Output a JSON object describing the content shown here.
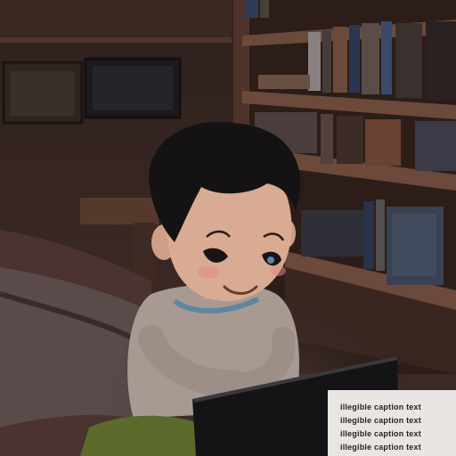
{
  "scene": {
    "palette": {
      "wall": "#3b2a27",
      "shelf_wood": "#5a3c30",
      "skin": "#d9ab93",
      "hair": "#141212",
      "shirt": "#b7aaa2",
      "tablet": "#141416",
      "pants": "#5c6a2c",
      "caption_bg": "#e9e5e2"
    },
    "icons": [
      "boy-figure",
      "bookshelf",
      "wall-picture",
      "bed",
      "tablet"
    ]
  },
  "caption": {
    "lines": [
      "illegible caption text",
      "illegible caption text",
      "illegible caption text",
      "illegible caption text"
    ]
  }
}
